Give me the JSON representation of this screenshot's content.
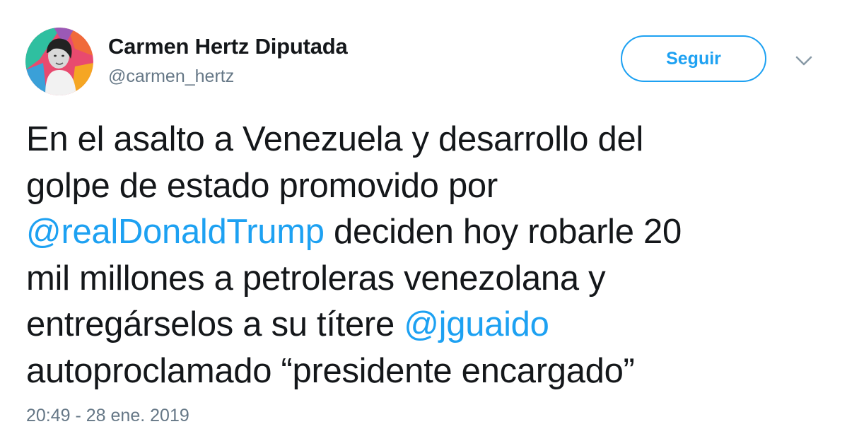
{
  "user": {
    "display_name": "Carmen Hertz Diputada",
    "handle": "@carmen_hertz",
    "avatar_icon": "profile-photo"
  },
  "follow_button": {
    "label": "Seguir"
  },
  "menu": {
    "icon": "chevron-down-icon"
  },
  "tweet": {
    "lines": [
      [
        {
          "text": "En el asalto a Venezuela y desarrollo del"
        }
      ],
      [
        {
          "text": "golpe de estado promovido por"
        }
      ],
      [
        {
          "text": "@realDonaldTrump",
          "mention": true
        },
        {
          "text": " deciden hoy robarle 20"
        }
      ],
      [
        {
          "text": "mil millones a petroleras venezolana y"
        }
      ],
      [
        {
          "text": "entregárselos a su títere "
        },
        {
          "text": "@jguaido",
          "mention": true
        }
      ],
      [
        {
          "text": "autoproclamado “presidente encargado”"
        }
      ]
    ],
    "timestamp": "20:49 - 28 ene. 2019"
  },
  "colors": {
    "accent": "#1da1f2",
    "text_primary": "#14171a",
    "text_secondary": "#657786"
  }
}
